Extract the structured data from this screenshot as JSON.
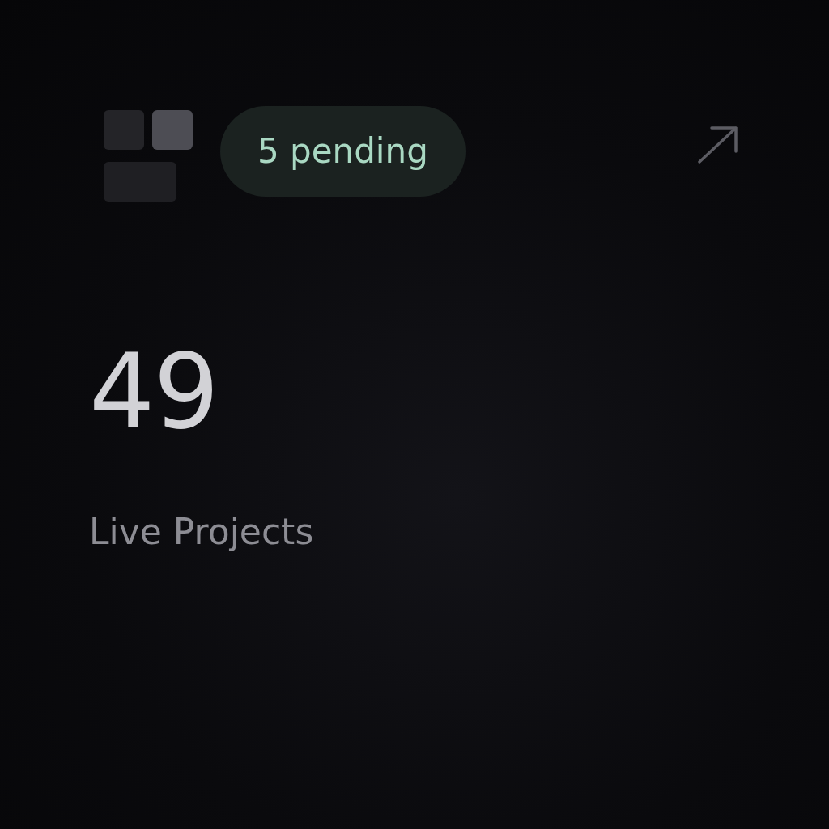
{
  "badge": {
    "label": "5 pending"
  },
  "metric": {
    "value": "49",
    "label": "Live Projects"
  }
}
